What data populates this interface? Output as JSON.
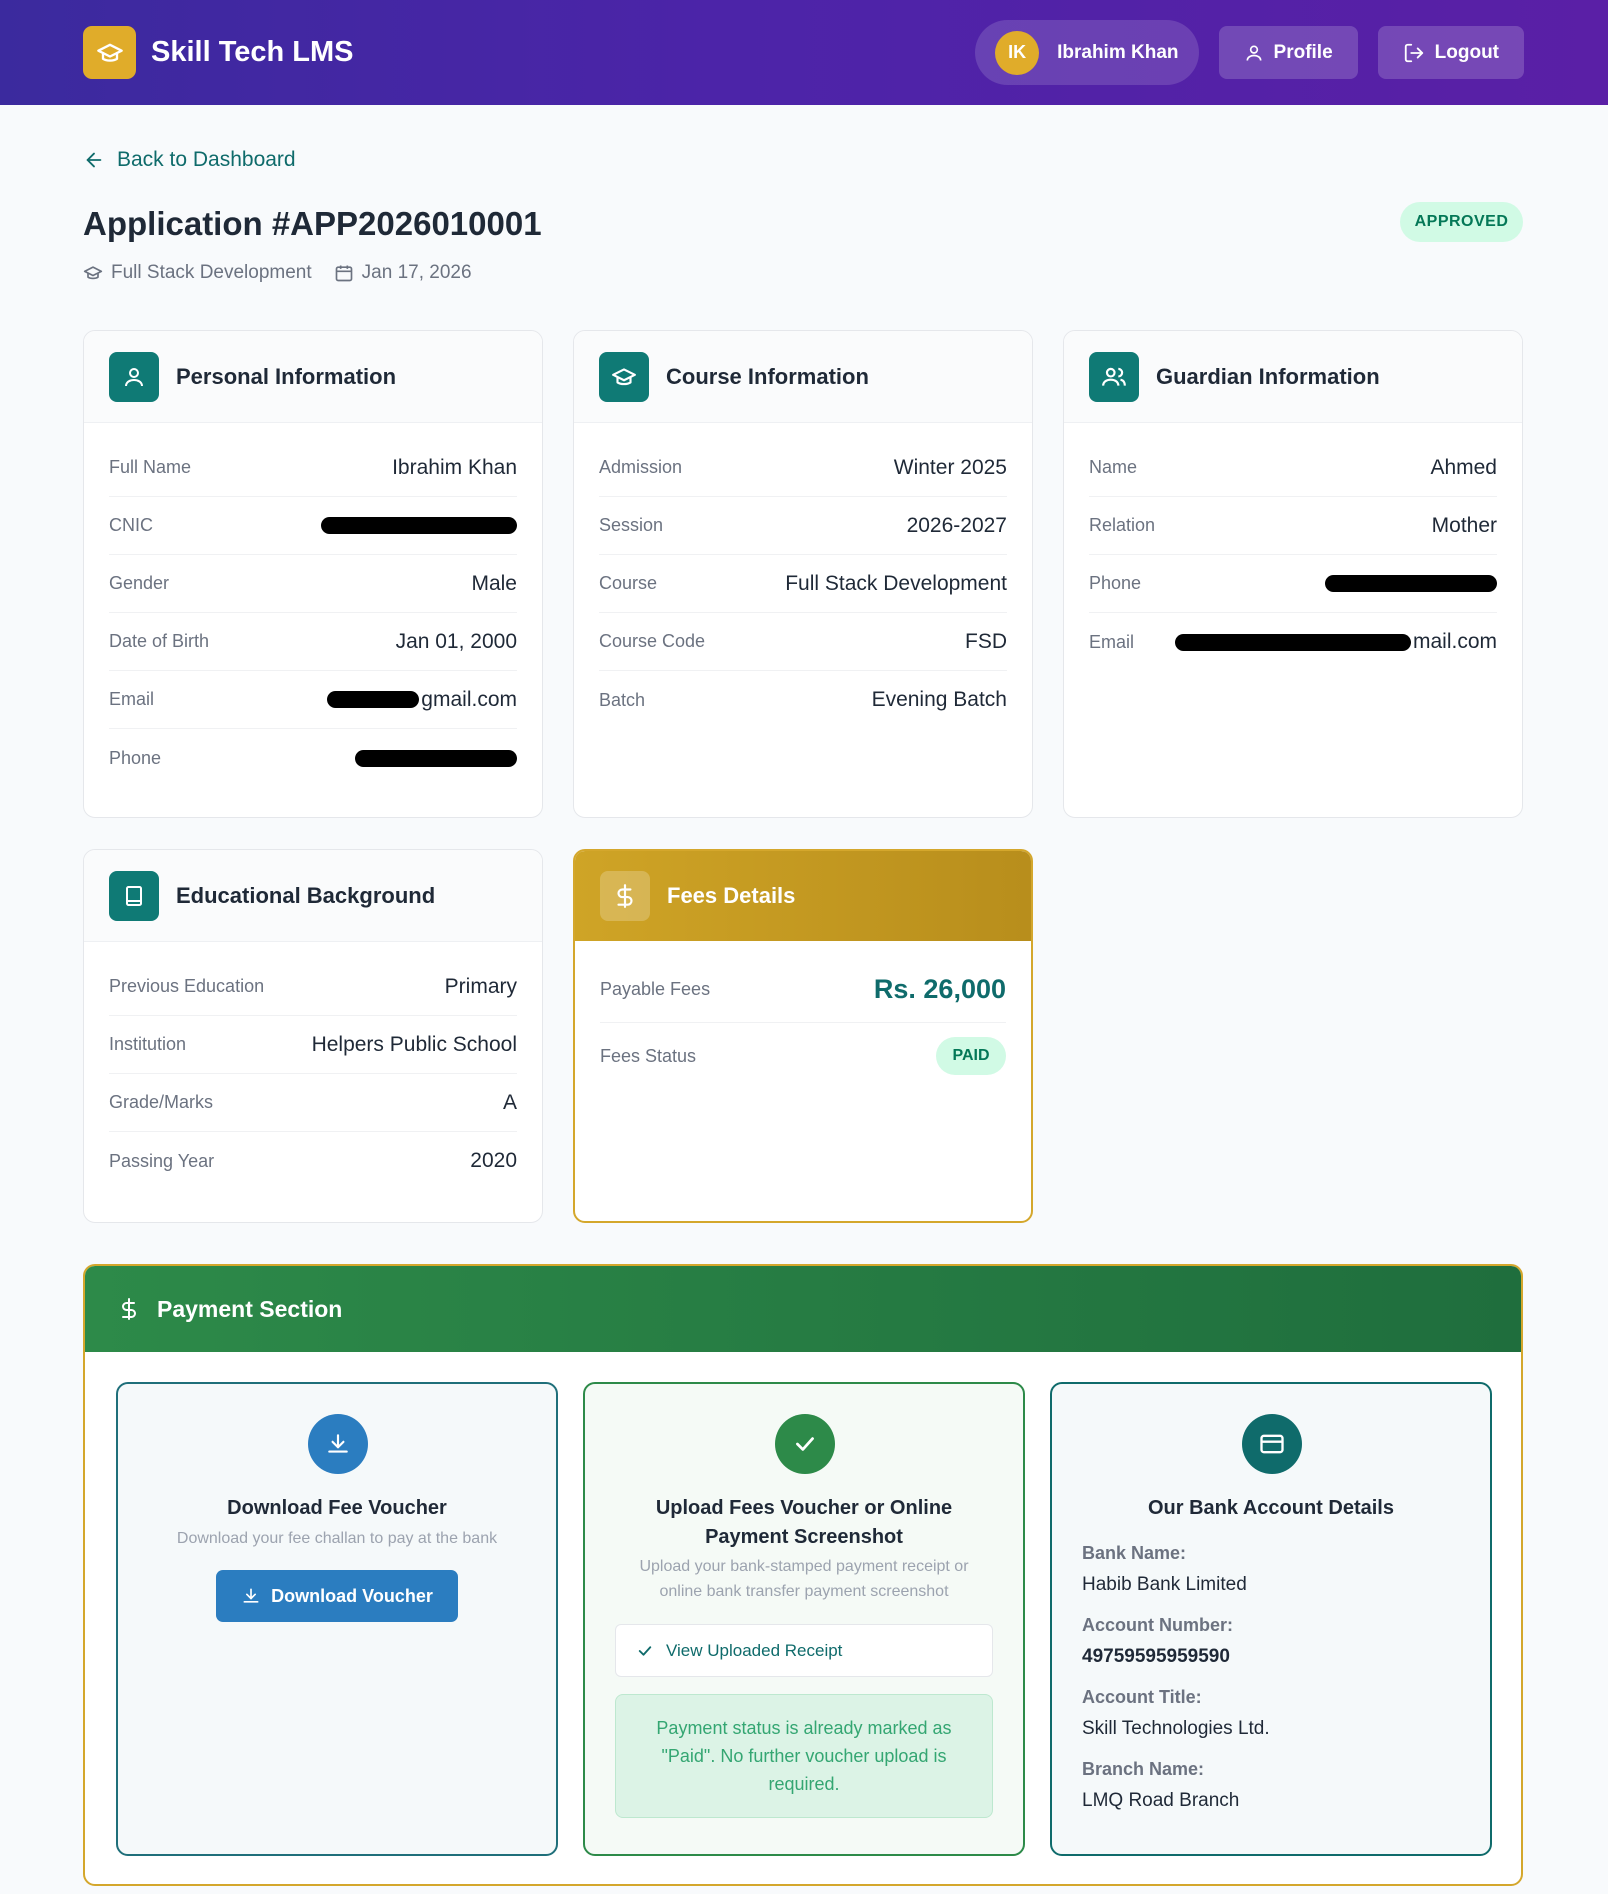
{
  "header": {
    "brand": "Skill Tech LMS",
    "user_initials": "IK",
    "user_name": "Ibrahim Khan",
    "profile_label": "Profile",
    "logout_label": "Logout"
  },
  "back_link": "Back to Dashboard",
  "application": {
    "title": "Application #APP2026010001",
    "status": "APPROVED",
    "course": "Full Stack Development",
    "date": "Jan 17, 2026"
  },
  "personal": {
    "title": "Personal Information",
    "rows": [
      {
        "label": "Full Name",
        "value": "Ibrahim Khan"
      },
      {
        "label": "CNIC",
        "value": ""
      },
      {
        "label": "Gender",
        "value": "Male"
      },
      {
        "label": "Date of Birth",
        "value": "Jan 01, 2000"
      },
      {
        "label": "Email",
        "value": "gmail.com"
      },
      {
        "label": "Phone",
        "value": ""
      }
    ]
  },
  "course": {
    "title": "Course Information",
    "rows": [
      {
        "label": "Admission",
        "value": "Winter 2025"
      },
      {
        "label": "Session",
        "value": "2026-2027"
      },
      {
        "label": "Course",
        "value": "Full Stack Development"
      },
      {
        "label": "Course Code",
        "value": "FSD"
      },
      {
        "label": "Batch",
        "value": "Evening Batch"
      }
    ]
  },
  "guardian": {
    "title": "Guardian Information",
    "rows": [
      {
        "label": "Name",
        "value": "Ahmed"
      },
      {
        "label": "Relation",
        "value": "Mother"
      },
      {
        "label": "Phone",
        "value": ""
      },
      {
        "label": "Email",
        "value": "mail.com"
      }
    ]
  },
  "education": {
    "title": "Educational Background",
    "rows": [
      {
        "label": "Previous Education",
        "value": "Primary"
      },
      {
        "label": "Institution",
        "value": "Helpers Public School"
      },
      {
        "label": "Grade/Marks",
        "value": "A"
      },
      {
        "label": "Passing Year",
        "value": "2020"
      }
    ]
  },
  "fees": {
    "title": "Fees Details",
    "payable_label": "Payable Fees",
    "payable_value": "Rs. 26,000",
    "status_label": "Fees Status",
    "status_value": "PAID"
  },
  "payment": {
    "title": "Payment Section",
    "download": {
      "title": "Download Fee Voucher",
      "subtitle": "Download your fee challan to pay at the bank",
      "button": "Download Voucher"
    },
    "upload": {
      "title_line1": "Upload Fees Voucher or Online",
      "title_line2": "Payment Screenshot",
      "subtitle_line1": "Upload your bank-stamped payment receipt or",
      "subtitle_line2": "online bank transfer payment screenshot",
      "view_receipt": "View Uploaded Receipt",
      "note_line1": "Payment status is already marked as",
      "note_line2": "\"Paid\". No further voucher upload is",
      "note_line3": "required."
    },
    "bank": {
      "title": "Our Bank Account Details",
      "bank_name_label": "Bank Name:",
      "bank_name": "Habib Bank Limited",
      "account_number_label": "Account Number:",
      "account_number": "49759595959590",
      "account_title_label": "Account Title:",
      "account_title": "Skill Technologies Ltd.",
      "branch_label": "Branch Name:",
      "branch": "LMQ Road Branch"
    }
  },
  "colors": {
    "header_start": "#3b2a9e",
    "header_end": "#5a1fa6",
    "brand_gold": "#e0ac2a",
    "teal": "#0f7a75",
    "payment_green": "#2d8a49",
    "download_blue": "#2b7dc0"
  }
}
